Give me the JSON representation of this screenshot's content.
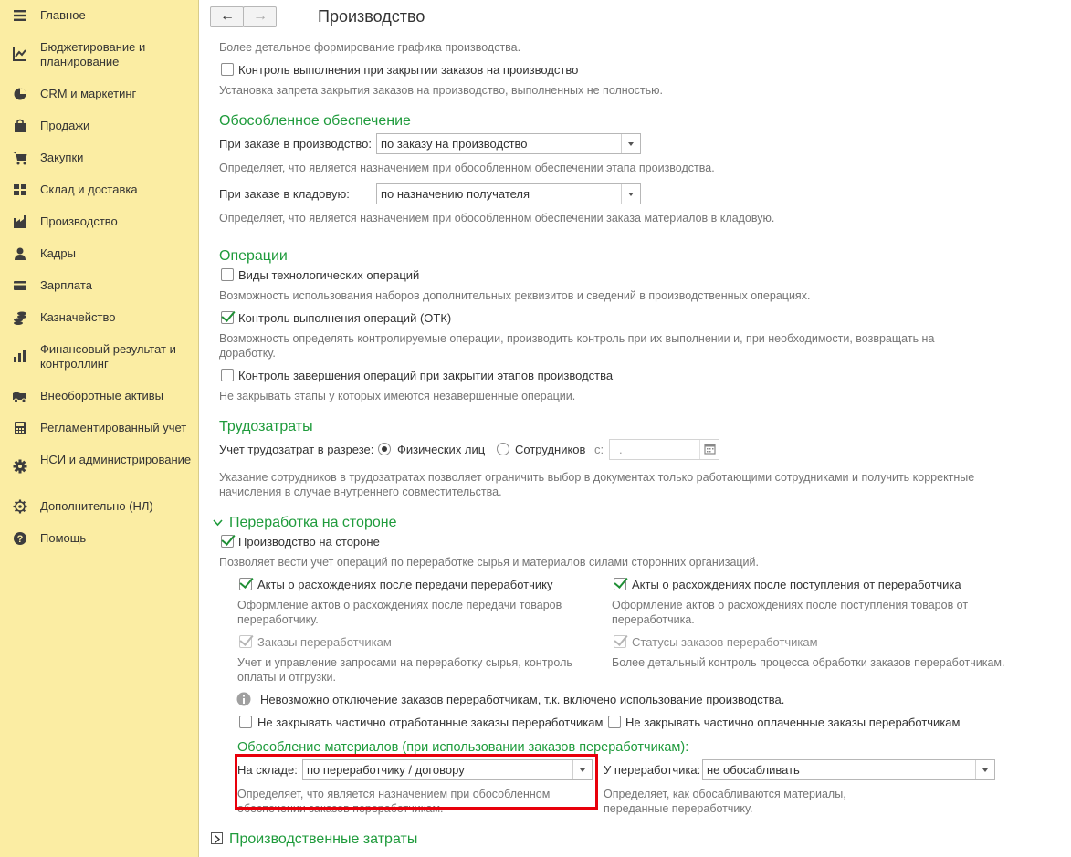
{
  "sidebar": {
    "items": [
      {
        "label": "Главное",
        "icon": "menu-icon"
      },
      {
        "label": "Бюджетирование и планирование",
        "icon": "chart-line-icon"
      },
      {
        "label": "CRM и маркетинг",
        "icon": "pie-chart-icon"
      },
      {
        "label": "Продажи",
        "icon": "bag-icon"
      },
      {
        "label": "Закупки",
        "icon": "cart-icon"
      },
      {
        "label": "Склад и доставка",
        "icon": "grid-icon"
      },
      {
        "label": "Производство",
        "icon": "factory-icon"
      },
      {
        "label": "Кадры",
        "icon": "person-icon"
      },
      {
        "label": "Зарплата",
        "icon": "card-icon"
      },
      {
        "label": "Казначейство",
        "icon": "coins-icon"
      },
      {
        "label": "Финансовый результат и контроллинг",
        "icon": "bar-chart-icon"
      },
      {
        "label": "Внеоборотные активы",
        "icon": "truck-icon"
      },
      {
        "label": "Регламентированный учет",
        "icon": "calculator-icon"
      },
      {
        "label": "НСИ и администрирование",
        "icon": "gear-icon"
      },
      {
        "label": "Дополнительно (НЛ)",
        "icon": "gear-outline-icon"
      },
      {
        "label": "Помощь",
        "icon": "help-icon"
      }
    ]
  },
  "header": {
    "title": "Производство",
    "back": "←",
    "forward": "→"
  },
  "top": {
    "hint1": "Более детальное формирование графика производства.",
    "control_close_label": "Контроль выполнения при закрытии заказов на производство",
    "hint2": "Установка запрета закрытия заказов на производство, выполненных не полностью."
  },
  "separate_supply": {
    "title": "Обособленное обеспечение",
    "prod_order_label": "При заказе в производство:",
    "prod_order_value": "по заказу на производство",
    "prod_order_hint": "Определяет, что является назначением при обособленном обеспечении этапа производства.",
    "store_order_label": "При заказе в кладовую:",
    "store_order_value": "по назначению получателя",
    "store_order_hint": "Определяет, что является назначением при обособленном обеспечении заказа материалов в кладовую."
  },
  "operations": {
    "title": "Операции",
    "tech_ops_label": "Виды технологических операций",
    "tech_ops_hint": "Возможность использования наборов дополнительных реквизитов и сведений в производственных операциях.",
    "otk_label": "Контроль выполнения операций (ОТК)",
    "otk_hint": "Возможность определять контролируемые операции, производить контроль при их выполнении и, при необходимости, возвращать на доработку.",
    "finish_label": "Контроль завершения операций при закрытии этапов производства",
    "finish_hint": "Не закрывать этапы у которых имеются незавершенные операции."
  },
  "labor": {
    "title": "Трудозатраты",
    "label": "Учет трудозатрат в разрезе:",
    "opt1": "Физических лиц",
    "opt2": "Сотрудников",
    "from_label": "с:",
    "date_value": ".",
    "hint": "Указание сотрудников в трудозатратах позволяет ограничить выбор в документах только работающими сотрудниками и получить корректные начисления в случае внутреннего совместительства."
  },
  "outsourcing": {
    "title": "Переработка на стороне",
    "main_label": "Производство на стороне",
    "main_hint": "Позволяет вести учет операций по переработке сырья и материалов силами сторонних организаций.",
    "acts_transfer_label": "Акты о расхождениях после передачи переработчику",
    "acts_transfer_hint": "Оформление актов о расхождениях после передачи товаров переработчику.",
    "acts_receipt_label": "Акты о расхождениях после поступления от переработчика",
    "acts_receipt_hint": "Оформление актов о расхождениях после поступления товаров от переработчика.",
    "orders_label": "Заказы переработчикам",
    "orders_hint": "Учет и управление запросами на переработку сырья, контроль оплаты и отгрузки.",
    "statuses_label": "Статусы заказов переработчикам",
    "statuses_hint": "Более детальный контроль процесса обработки заказов переработчикам.",
    "info": "Невозможно отключение заказов переработчикам, т.к. включено использование производства.",
    "not_close_worked_label": "Не закрывать частично отработанные заказы переработчикам",
    "not_close_paid_label": "Не закрывать частично оплаченные заказы переработчикам",
    "materials_title": "Обособление материалов (при использовании заказов переработчикам):",
    "warehouse_label": "На складе:",
    "warehouse_value": "по переработчику / договору",
    "warehouse_hint": "Определяет, что является назначением при обособленном обеспечении заказов переработчикам.",
    "processor_label": "У переработчика:",
    "processor_value": "не обосабливать",
    "processor_hint": "Определяет, как обосабливаются материалы, переданные переработчику."
  },
  "costs": {
    "title": "Производственные затраты"
  },
  "colors": {
    "accent_green": "#1f9b3c",
    "sidebar_bg": "#fbeda3",
    "highlight_red": "#e8000b"
  }
}
